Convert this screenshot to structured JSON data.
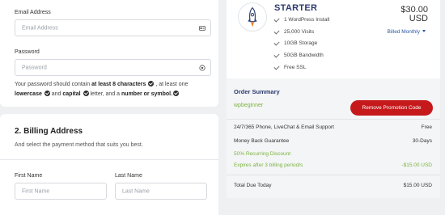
{
  "account": {
    "email_label": "Email Address",
    "email_placeholder": "Email Address",
    "password_label": "Password",
    "password_placeholder": "Password",
    "hint": {
      "p1": "Your password should contain ",
      "p2": "at least 8 characters",
      "p3": " , at least one ",
      "p4": "lowercase",
      "p5": " and ",
      "p6": "capital",
      "p7": " letter, and a ",
      "p8": "number or symbol."
    }
  },
  "billing": {
    "title": "2. Billing Address",
    "subtitle": "And select the payment method that suits you best.",
    "first_name_label": "First Name",
    "first_name_placeholder": "First Name",
    "last_name_label": "Last Name",
    "last_name_placeholder": "Last Name"
  },
  "plan": {
    "name": "STARTER",
    "price_amount": "$30.00",
    "price_currency": "USD",
    "billing_cycle": "Billed Monthly",
    "features": [
      "1 WordPress Install",
      "25,000 Visits",
      "10GB Storage",
      "50GB Bandwidth",
      "Free SSL"
    ]
  },
  "order_summary": {
    "title": "Order Summary",
    "coupon_code": "wpbeginner",
    "remove_button": "Remove Promotion Code",
    "lines": [
      {
        "label": "24/7/365 Phone, LiveChat & Email Support",
        "value": "Free"
      },
      {
        "label": "Money Back Guarantee",
        "value": "30-Days"
      }
    ],
    "discount_label": "50% Recurring Discount",
    "discount_note": "Expires after 3 billing period/s",
    "discount_value": "-$15.00 USD",
    "total_label": "Total Due Today",
    "total_value": "$15.00 USD"
  },
  "colors": {
    "brand_navy": "#2b3b6e",
    "accent_red": "#c6191c",
    "discount_green": "#7cb342",
    "link_blue": "#2b57a8"
  }
}
